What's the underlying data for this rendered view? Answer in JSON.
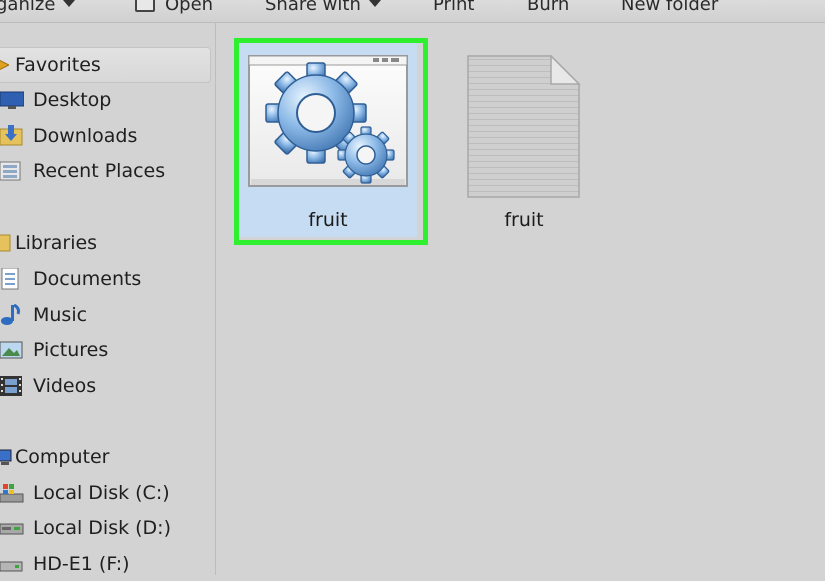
{
  "toolbar": {
    "organize": "ganize",
    "open": "Open",
    "share_with": "Share with",
    "print": "Print",
    "burn": "Burn",
    "new_folder": "New folder"
  },
  "nav": {
    "favorites": {
      "header": "Favorites",
      "items": [
        "Desktop",
        "Downloads",
        "Recent Places"
      ]
    },
    "libraries": {
      "header": "Libraries",
      "items": [
        "Documents",
        "Music",
        "Pictures",
        "Videos"
      ]
    },
    "computer": {
      "header": "Computer",
      "items": [
        "Local Disk (C:)",
        "Local Disk (D:)",
        "HD-E1 (F:)"
      ]
    }
  },
  "files": [
    {
      "name": "fruit",
      "icon": "application-gears-icon",
      "selected": true
    },
    {
      "name": "fruit",
      "icon": "text-document-icon",
      "selected": false
    }
  ],
  "colors": {
    "background": "#d3d3d3",
    "selection_highlight": "#2ef02e",
    "selection_fill": "#c6dcf3"
  }
}
